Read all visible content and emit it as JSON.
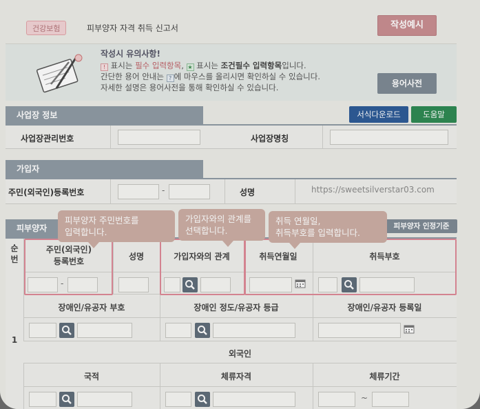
{
  "header": {
    "badge": "건강보험",
    "title": "피부양자 자격 취득 신고서",
    "example_button": "작성예시"
  },
  "notice": {
    "title": "작성시 유의사항!",
    "line1_pre": " 표시는 ",
    "line1_req": "필수 입력항목",
    "line1_mid": ", ",
    "line1_mid2": " 표시는 ",
    "line1_opt": "조건필수 입력항목",
    "line1_post": "입니다.",
    "line2_pre": "간단한 용어 안내는 ",
    "line2_post": "에 마우스를 올리시면 확인하실 수 있습니다.",
    "line3": "자세한 설명은 용어사전을 통해 확인하실 수 있습니다.",
    "dict_button": "용어사전",
    "mark_required": "!",
    "mark_conditional": "★",
    "mark_help": "?"
  },
  "workplace": {
    "section_title": "사업장 정보",
    "download_button": "서식다운로드",
    "help_button": "도움말",
    "mgmt_no_label": "사업장관리번호",
    "name_label": "사업장명칭"
  },
  "subscriber": {
    "section_title": "가입자",
    "rrn_label": "주민(외국인)등록번호",
    "rrn_sep": "-",
    "name_label": "성명",
    "watermark": "https://sweetsilverstar03.com"
  },
  "dependent": {
    "section_title": "피부양자",
    "criteria_button": "피부양자 인정기준",
    "col_no": "순번",
    "col_no_l1": "순",
    "col_no_l2": "번",
    "col_rrn_l1": "주민(외국인)",
    "col_rrn_l2": "등록번호",
    "col_name": "성명",
    "col_relation": "가입자와의 관계",
    "col_acq_date": "취득연월일",
    "col_acq_code": "취득부호",
    "rrn_sep": "-",
    "row_no": "1",
    "col_disabled_code": "장애인/유공자 부호",
    "col_disabled_grade": "장애인 정도/유공자 등급",
    "col_disabled_date": "장애인/유공자 등록일",
    "foreigner": "외국인",
    "col_nationality": "국적",
    "col_visa": "체류자격",
    "col_stay_period": "체류기간",
    "period_sep": "~"
  },
  "tooltips": {
    "rrn_l1": "피부양자 주민번호를",
    "rrn_l2": "입력합니다.",
    "rel_l1": "가입자와의 관계를",
    "rel_l2": "선택합니다.",
    "acq_l1": "취득 연월일,",
    "acq_l2": "취득부호를 입력합니다."
  }
}
